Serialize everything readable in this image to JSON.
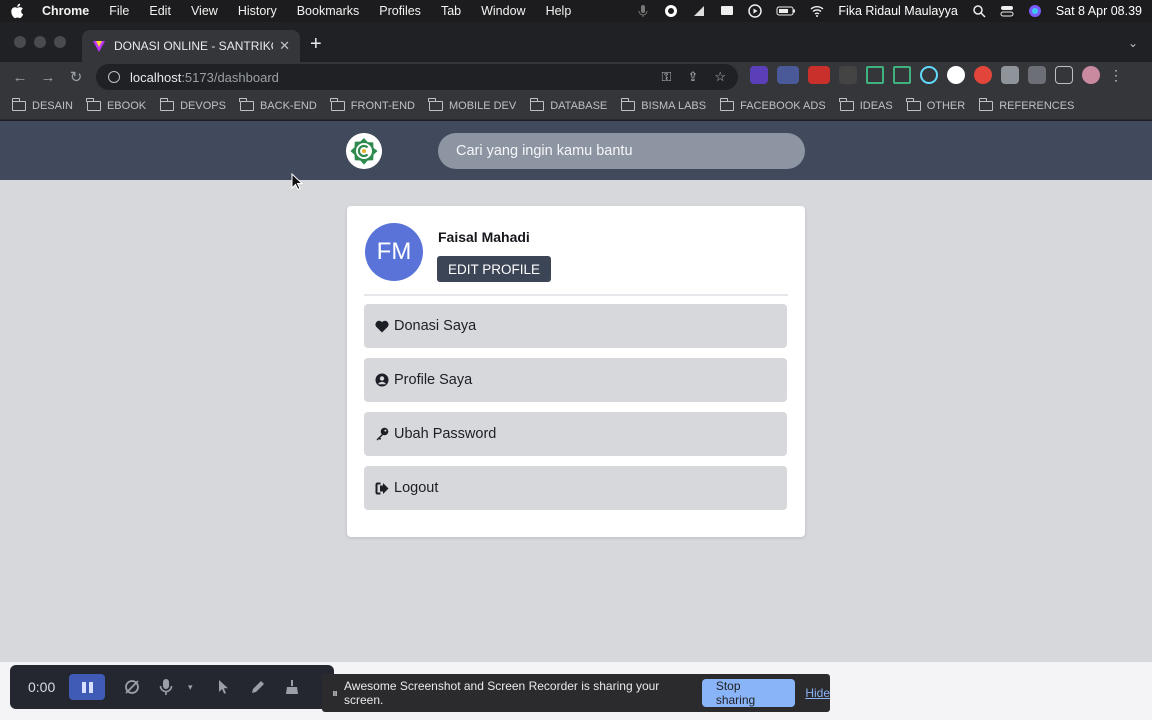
{
  "menubar": {
    "app": "Chrome",
    "items": [
      "File",
      "Edit",
      "View",
      "History",
      "Bookmarks",
      "Profiles",
      "Tab",
      "Window",
      "Help"
    ],
    "user": "Fika Ridaul Maulayya",
    "datetime": "Sat 8 Apr  08.39"
  },
  "browser": {
    "tab_title": "DONASI ONLINE - SANTRIKODI",
    "url_host": "localhost",
    "url_path": ":5173/dashboard",
    "bookmarks": [
      "DESAIN",
      "EBOOK",
      "DEVOPS",
      "BACK-END",
      "FRONT-END",
      "MOBILE DEV",
      "DATABASE",
      "BISMA LABS",
      "FACEBOOK ADS",
      "IDEAS",
      "OTHER",
      "REFERENCES"
    ]
  },
  "site": {
    "search_placeholder": "Cari yang ingin kamu bantu"
  },
  "profile": {
    "initials": "FM",
    "name": "Faisal Mahadi",
    "edit_label": "EDIT PROFILE"
  },
  "menu": [
    {
      "label": "Donasi Saya",
      "icon": "heart-icon"
    },
    {
      "label": "Profile Saya",
      "icon": "user-circle-icon"
    },
    {
      "label": "Ubah Password",
      "icon": "key-icon"
    },
    {
      "label": "Logout",
      "icon": "sign-out-icon"
    }
  ],
  "recorder": {
    "timer": "0:00",
    "share_text": "Awesome Screenshot and Screen Recorder is sharing your screen.",
    "stop_label": "Stop sharing",
    "hide_label": "Hide"
  },
  "colors": {
    "header": "#414a5c",
    "avatar": "#5a73d8",
    "button": "#3c4555",
    "page_bg": "#d6d8dc"
  }
}
